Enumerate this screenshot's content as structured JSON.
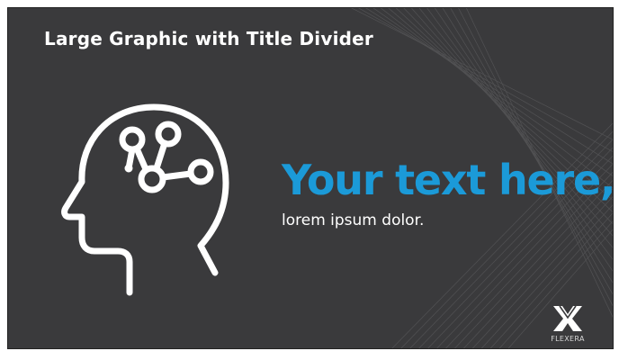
{
  "slide": {
    "title": "Large Graphic with Title Divider",
    "headline": "Your text here,",
    "subtext": "lorem ipsum dolor.",
    "icon": "head-network-icon",
    "logo_text": "FLEXERA",
    "colors": {
      "background": "#3a3a3c",
      "accent": "#1b9ad8",
      "text": "#ffffff"
    }
  }
}
